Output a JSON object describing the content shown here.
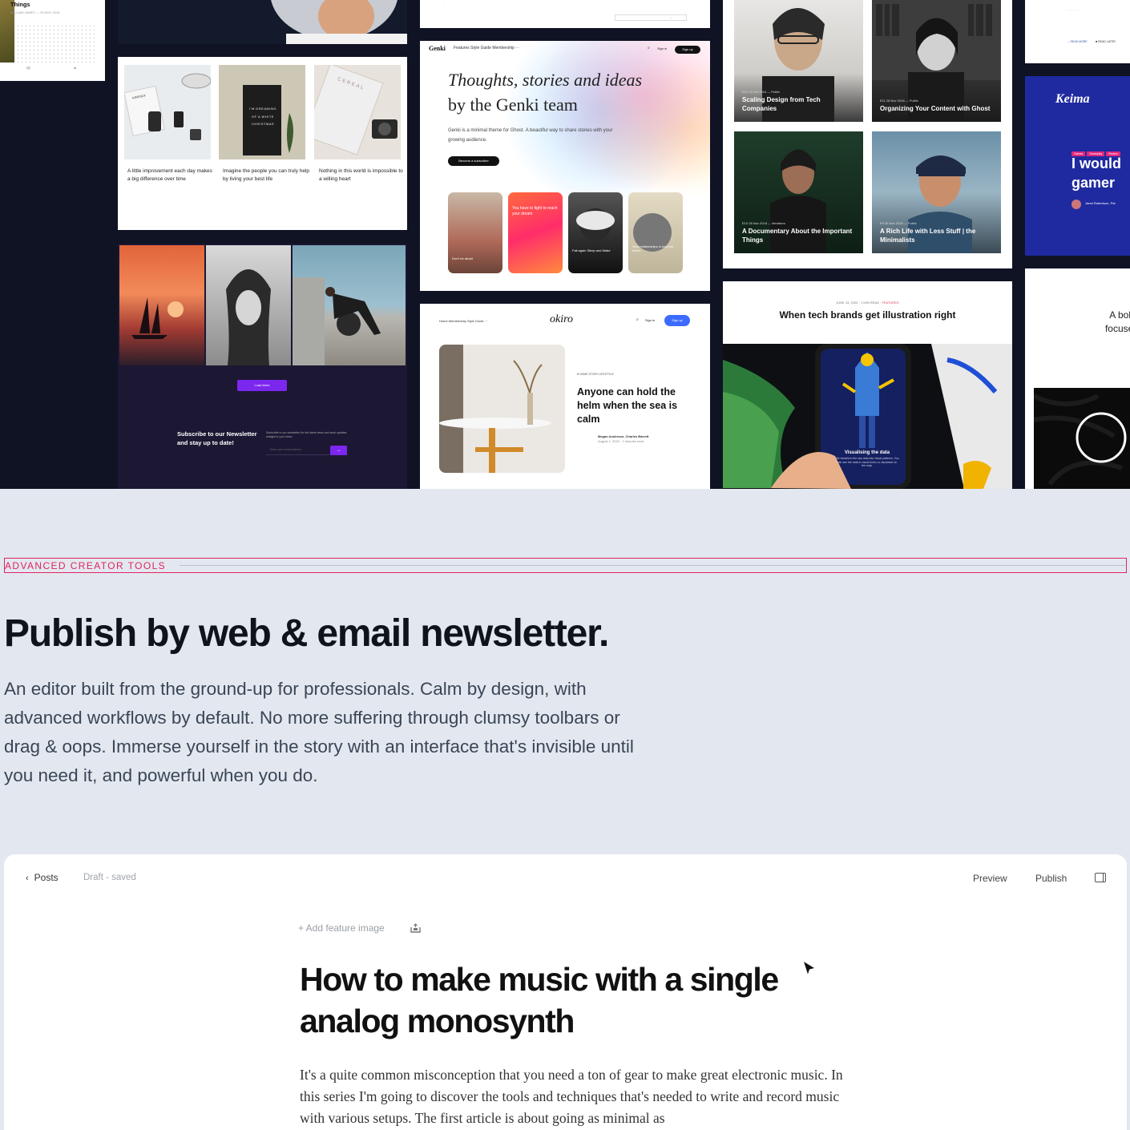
{
  "gallery": {
    "card_a": {
      "title": "Things",
      "meta": "WILLIAM JAMES — 29 NOV 2018"
    },
    "card_c": {
      "captions": [
        "A little improvement each day makes a big difference over time",
        "Imagine the people you can truly help by living your best life",
        "Nothing in this world is impossible to a willing heart"
      ],
      "letterboard": "I'M DREAMING OF A WHITE CHRISTMAS",
      "cereal_label": "CEREAL",
      "notebook_label": "KINFOLK"
    },
    "card_d": {
      "load_more": "Load More",
      "subscribe": "Subscribe to our Newsletter and stay up to date!",
      "subscribe_sub": "Subscribe to our newsletter for the latest news and work updates straight to your inbox.",
      "email_placeholder": "Enter your email address",
      "arrow": "→"
    },
    "card_f": {
      "logo": "Genki",
      "nav": "Features   Style Guide   Membership   ···",
      "signin": "Sign in",
      "signup": "Sign up",
      "hero_italic": "Thoughts, stories and ideas",
      "hero_rest": "by the Genki team",
      "intro": "Genki is a minimal theme for Ghost. A beautiful way to share stories with your growing audience.",
      "cta": "Become a subscriber",
      "tiles": [
        "Don't be afraid",
        "You have to fight to reach your dream",
        "Fall again Sleep and Wake",
        "Your relationships in love are worth..."
      ]
    },
    "card_g": {
      "nav": "Home   Membership   Style Guide   ···",
      "logo": "okiro",
      "signin": "Sign in",
      "signup": "Sign up",
      "tags": "♥  HOME  STORY  LIFESTYLE",
      "headline": "Anyone can hold the helm when the sea is calm",
      "author": "Megan Anderson, Charles Barrett",
      "date": "August 1, 2020 · 2 minutes read"
    },
    "card_h": {
      "episodes": [
        {
          "meta": "E12  16 Oct 2018 — Public",
          "title": "Scaling Design from Tech Companies"
        },
        {
          "meta": "E11  28 Nov 2018 — Public",
          "title": "Organizing Your Content with Ghost"
        },
        {
          "meta": "E10  28 Nov 2018 — Members",
          "title": "A Documentary About the Important Things"
        },
        {
          "meta": "E9  28 Nov 2018 — Public",
          "title": "A Rich Life with Less Stuff | the Minimalists"
        }
      ]
    },
    "card_i": {
      "meta": "JUNE 15, 2020 · 1 MIN READ ·",
      "tag": "FEATURED",
      "title": "When tech brands get illustration right",
      "caption": "Visualising the data",
      "caption_sub": "We transform the raw data into visual patterns. You can see the data in visual forms or visualised on the map."
    },
    "card_k": {
      "logo": "Keima",
      "tags": [
        "Games",
        "Gameplay",
        "Review"
      ],
      "headline": "I would gamer",
      "author": "Janet Robertson, Pat"
    },
    "card_l": {
      "text": "A bold, focused"
    },
    "card_j": {
      "read_more": "→ READ MORE",
      "read_later": "■ READ LATER"
    }
  },
  "section": {
    "eyebrow": "ADVANCED CREATOR TOOLS",
    "title": "Publish by web & email newsletter.",
    "description": "An editor built from the ground-up for professionals. Calm by design, with advanced workflows by default. No more suffering through clumsy toolbars or drag & oops. Immerse yourself in the story with an interface that's invisible until you need it, and powerful when you do."
  },
  "editor": {
    "back_label": "Posts",
    "back_icon": "chevron-left-icon",
    "status": "Draft - saved",
    "preview": "Preview",
    "publish": "Publish",
    "feature_image": "+ Add feature image",
    "post_title": "How to make music with a single analog monosynth",
    "post_body": "It's a quite common misconception that you need a ton of gear to make great electronic music. In this series I'm going to discover the tools and techniques that's needed to write and record music with various setups. The first article is about going as minimal as"
  },
  "colors": {
    "accent": "#e0245e",
    "page_bg": "#e3e8f0",
    "gallery_bg": "#0f1324"
  }
}
